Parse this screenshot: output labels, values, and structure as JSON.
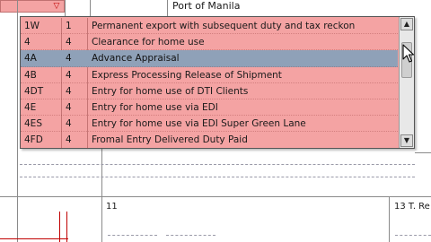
{
  "form": {
    "port_label": "Port of Manila",
    "box11_label": "11",
    "box13_label": "13 T. Re"
  },
  "dropdown": {
    "selected_code": "4A",
    "items": [
      {
        "code": "1W",
        "num": "1",
        "desc": "Permanent export with subsequent duty and tax reckon"
      },
      {
        "code": "4",
        "num": "4",
        "desc": "Clearance for home use"
      },
      {
        "code": "4A",
        "num": "4",
        "desc": "Advance Appraisal"
      },
      {
        "code": "4B",
        "num": "4",
        "desc": "Express Processing Release of Shipment"
      },
      {
        "code": "4DT",
        "num": "4",
        "desc": "Entry for home use of DTI Clients"
      },
      {
        "code": "4E",
        "num": "4",
        "desc": "Entry for home use via EDI"
      },
      {
        "code": "4ES",
        "num": "4",
        "desc": "Entry for home use via EDI Super Green Lane"
      },
      {
        "code": "4FD",
        "num": "4",
        "desc": "Fromal Entry Delivered Duty Paid"
      }
    ]
  },
  "colors": {
    "list_bg": "#f4a3a3",
    "selected_bg": "#8fa1b8"
  },
  "icons": {
    "dropdown_arrow": "triangle-down",
    "scroll_up": "triangle-up",
    "scroll_down": "triangle-down",
    "cursor": "arrow-pointer"
  }
}
